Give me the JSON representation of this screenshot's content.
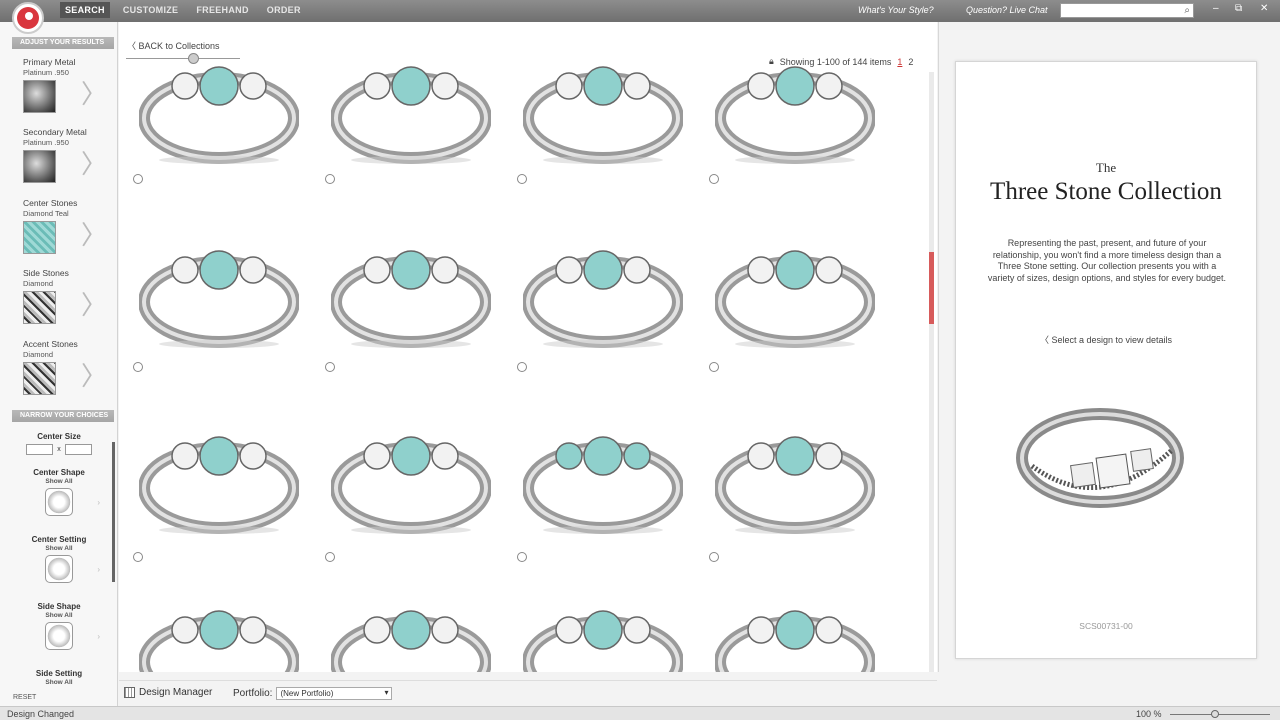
{
  "nav": {
    "tabs": [
      {
        "label": "SEARCH",
        "active": true
      },
      {
        "label": "CUSTOMIZE",
        "active": false
      },
      {
        "label": "FREEHAND",
        "active": false
      },
      {
        "label": "ORDER",
        "active": false
      }
    ],
    "style_link": "What's Your Style?",
    "chat_link": "Question? Live Chat",
    "search_placeholder": "",
    "search_icon": "search-icon",
    "window_controls": [
      "–",
      "⧉",
      "✕"
    ]
  },
  "sidebar": {
    "adjust_header": "ADJUST YOUR RESULTS",
    "options": [
      {
        "name": "Primary Metal",
        "value": "Platinum .950",
        "swatch": "metal"
      },
      {
        "name": "Secondary Metal",
        "value": "Platinum .950",
        "swatch": "metal"
      },
      {
        "name": "Center Stones",
        "value": "Diamond Teal",
        "swatch": "teal"
      },
      {
        "name": "Side Stones",
        "value": "Diamond",
        "swatch": "diamond"
      },
      {
        "name": "Accent Stones",
        "value": "Diamond",
        "swatch": "diamond"
      }
    ],
    "narrow_header": "NARROW YOUR CHOICES",
    "center_size": {
      "label": "Center Size",
      "sep": "x"
    },
    "filters": [
      {
        "label": "Center Shape",
        "sub": "Show All"
      },
      {
        "label": "Center Setting",
        "sub": "Show All"
      },
      {
        "label": "Side Shape",
        "sub": "Show All"
      },
      {
        "label": "Side Setting",
        "sub": "Show All"
      }
    ],
    "reset": "RESET"
  },
  "main": {
    "back": "BACK to Collections",
    "showing": "Showing 1-100 of 144 items",
    "pages": [
      "1",
      "2"
    ],
    "rings": [
      {
        "stones": [
          "white",
          "teal",
          "white"
        ]
      },
      {
        "stones": [
          "white",
          "teal",
          "white"
        ]
      },
      {
        "stones": [
          "white",
          "teal",
          "white"
        ]
      },
      {
        "stones": [
          "white",
          "teal",
          "white"
        ]
      },
      {
        "stones": [
          "white",
          "teal",
          "white"
        ]
      },
      {
        "stones": [
          "white",
          "teal",
          "white"
        ]
      },
      {
        "stones": [
          "white",
          "teal",
          "white"
        ]
      },
      {
        "stones": [
          "white",
          "teal",
          "white"
        ]
      },
      {
        "stones": [
          "white",
          "teal",
          "white"
        ]
      },
      {
        "stones": [
          "white",
          "teal",
          "white"
        ]
      },
      {
        "stones": [
          "teal",
          "teal",
          "teal"
        ]
      },
      {
        "stones": [
          "white",
          "teal",
          "white"
        ]
      },
      {
        "stones": [
          "white",
          "teal",
          "white"
        ]
      },
      {
        "stones": [
          "white",
          "teal",
          "white"
        ]
      },
      {
        "stones": [
          "white",
          "teal",
          "white"
        ]
      },
      {
        "stones": [
          "white",
          "teal",
          "white"
        ]
      }
    ]
  },
  "detail": {
    "the": "The",
    "title": "Three Stone Collection",
    "description": "Representing the past, present, and future of your relationship, you won't find a more timeless design than a Three Stone setting. Our collection presents you with a variety of sizes, design options, and styles for every budget.",
    "hint": "Select a design to view details",
    "sku": "SCS00731-00"
  },
  "bottom": {
    "design_manager": "Design Manager",
    "portfolio_label": "Portfolio:",
    "portfolio_value": "(New Portfolio)"
  },
  "status": {
    "left": "Design Changed",
    "zoom": "100 %"
  },
  "colors": {
    "accent": "#d9363e",
    "teal_stone": "#8fd0cc",
    "metal": "#9a9a9a"
  }
}
